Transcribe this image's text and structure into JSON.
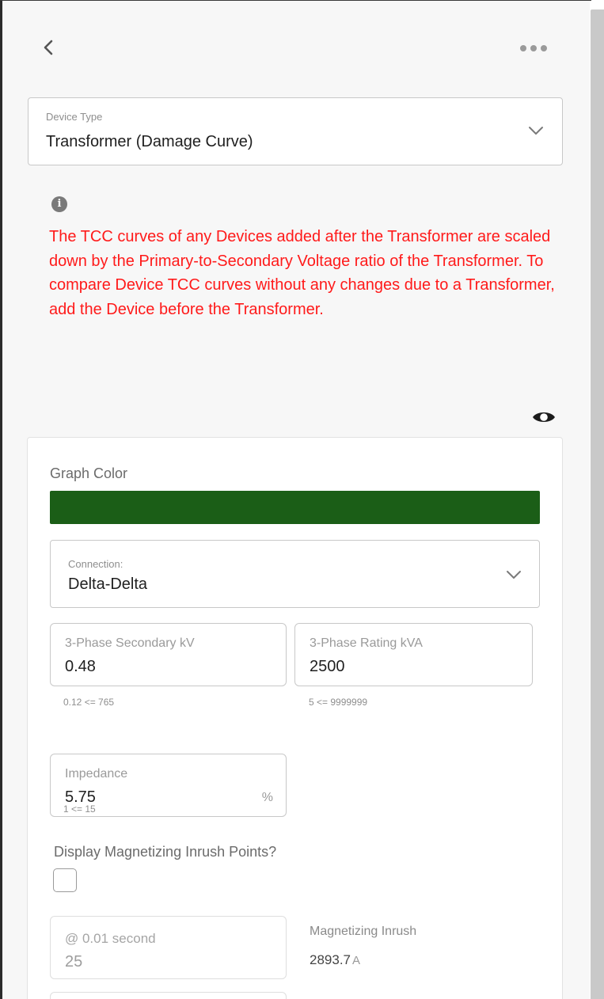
{
  "header": {
    "back_icon": "chevron-left-icon",
    "more_icon": "more-horizontal-icon"
  },
  "device_type": {
    "label": "Device Type",
    "value": "Transformer (Damage Curve)"
  },
  "info": {
    "icon": "info-icon",
    "warning": "The TCC curves of any Devices added after the Transformer are scaled down by the Primary-to-Secondary Voltage ratio of the Transformer. To compare Device TCC curves without any changes due to a Transformer, add the Device before the Transformer.",
    "warning_color": "#ff1a1a",
    "visibility_icon": "eye-icon"
  },
  "graph_color": {
    "label": "Graph Color",
    "color": "#1b5e17"
  },
  "connection": {
    "label": "Connection:",
    "value": "Delta-Delta"
  },
  "fields": {
    "secondary_kv": {
      "label": "3-Phase Secondary kV",
      "value": "0.48",
      "hint": "0.12 <= 765"
    },
    "rating_kva": {
      "label": "3-Phase Rating kVA",
      "value": "2500",
      "hint": "5 <= 9999999"
    },
    "impedance": {
      "label": "Impedance",
      "value": "5.75",
      "unit": "%",
      "hint": "1 <= 15"
    }
  },
  "inrush": {
    "question": "Display Magnetizing Inrush Points?",
    "checked": false,
    "point_label": "@ 0.01 second",
    "point_value": "25",
    "result_label": "Magnetizing Inrush",
    "result_value": "2893.7",
    "result_unit": "A"
  }
}
